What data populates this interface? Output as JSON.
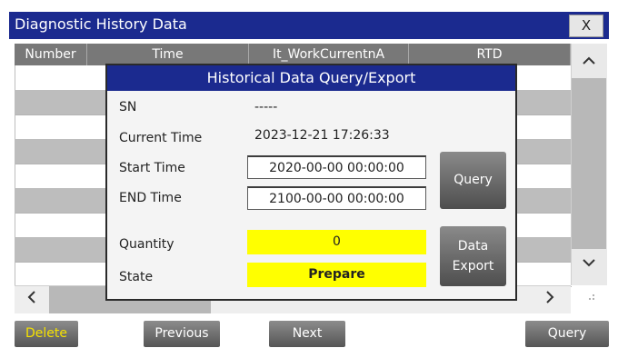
{
  "window": {
    "title": "Diagnostic History Data",
    "close_label": "X"
  },
  "table": {
    "columns": [
      "Number",
      "Time",
      "It_WorkCurrentnA",
      "RTD"
    ]
  },
  "scroll": {
    "up": "^",
    "down": "v",
    "left": "<",
    "right": ">",
    "grip": ".::"
  },
  "toolbar": {
    "delete": "Delete",
    "previous": "Previous",
    "next": "Next",
    "query": "Query"
  },
  "dialog": {
    "title": "Historical Data Query/Export",
    "sn_label": "SN",
    "sn_value": "-----",
    "current_time_label": "Current Time",
    "current_time_value": "2023-12-21 17:26:33",
    "start_time_label": "Start Time",
    "start_time_value": "2020-00-00 00:00:00",
    "end_time_label": "END Time",
    "end_time_value": "2100-00-00 00:00:00",
    "quantity_label": "Quantity",
    "quantity_value": "0",
    "state_label": "State",
    "state_value": "Prepare",
    "query_button": "Query",
    "export_button_line1": "Data",
    "export_button_line2": "Export"
  },
  "colors": {
    "title_bar": "#1b2a8f",
    "highlight": "#ffff00",
    "delete_text": "#f5e100"
  }
}
